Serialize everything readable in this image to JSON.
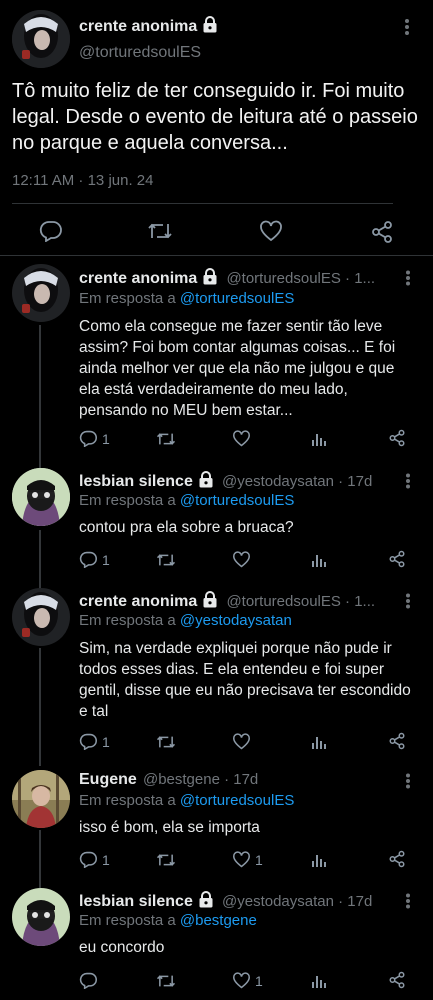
{
  "main_tweet": {
    "author_name": "crente anonima",
    "handle": "@torturedsoulES",
    "text": "Tô muito feliz de ter conseguido ir. Foi muito legal. Desde o evento de leitura até o passeio no parque e aquela conversa...",
    "timestamp": "12:11 AM · 13 jun. 24"
  },
  "replies": [
    {
      "author_name": "crente anonima",
      "handle_time": "@torturedsoulES · 1...",
      "in_reply_label": "Em resposta a",
      "in_reply_to": "@torturedsoulES",
      "text": "Como ela consegue me fazer sentir tão leve assim? Foi bom contar algumas coisas... E foi ainda melhor ver que ela não me julgou e que ela está verdadeiramente do meu lado, pensando no MEU bem estar...",
      "reply_count": "1",
      "like_count": ""
    },
    {
      "author_name": "lesbian silence",
      "handle_time": "@yestodaysatan · 17d",
      "in_reply_label": "Em resposta a",
      "in_reply_to": "@torturedsoulES",
      "text": "contou pra ela sobre a bruaca?",
      "reply_count": "1",
      "like_count": ""
    },
    {
      "author_name": "crente anonima",
      "handle_time": "@torturedsoulES · 1...",
      "in_reply_label": "Em resposta a",
      "in_reply_to": "@yestodaysatan",
      "text": "Sim, na verdade expliquei porque não pude ir todos esses dias. E ela entendeu e foi super gentil, disse que eu não precisava ter escondido e tal",
      "reply_count": "1",
      "like_count": ""
    },
    {
      "author_name": "Eugene",
      "handle_time": "@bestgene · 17d",
      "in_reply_label": "Em resposta a",
      "in_reply_to": "@torturedsoulES",
      "text": "isso é bom, ela se importa",
      "reply_count": "1",
      "like_count": "1"
    },
    {
      "author_name": "lesbian silence",
      "handle_time": "@yestodaysatan · 17d",
      "in_reply_label": "Em resposta a",
      "in_reply_to": "@bestgene",
      "text": "eu concordo",
      "reply_count": "",
      "like_count": "1"
    }
  ],
  "colors": {
    "background": "#000000",
    "link": "#1d9bf0",
    "muted": "#71767b",
    "text": "#e7e9ea"
  },
  "icons": [
    "lock-icon",
    "more-icon",
    "reply-icon",
    "retweet-icon",
    "like-icon",
    "share-icon",
    "views-icon"
  ]
}
